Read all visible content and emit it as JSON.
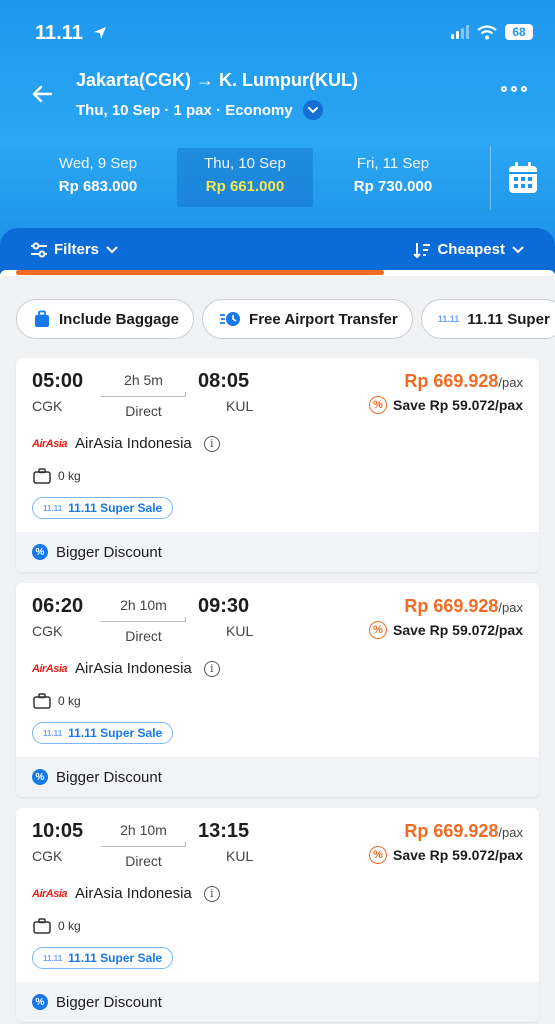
{
  "status_bar": {
    "time": "11.11",
    "battery": "68"
  },
  "header": {
    "route": "Jakarta(CGK) → K. Lumpur(KUL)",
    "subinfo": "Thu, 10 Sep · 1 pax · Economy"
  },
  "dates": [
    {
      "date": "Wed, 9 Sep",
      "price": "Rp 683.000"
    },
    {
      "date": "Thu, 10 Sep",
      "price": "Rp 661.000",
      "selected": true
    },
    {
      "date": "Fri, 11 Sep",
      "price": "Rp 730.000"
    }
  ],
  "filter_bar": {
    "filters_label": "Filters",
    "sort_label": "Cheapest"
  },
  "chips": [
    "Include Baggage",
    "Free Airport Transfer",
    "11.11 Super"
  ],
  "flights": [
    {
      "dep_time": "05:00",
      "dep_airport": "CGK",
      "duration": "2h 5m",
      "stops": "Direct",
      "arr_time": "08:05",
      "arr_airport": "KUL",
      "price": "Rp 669.928",
      "per": "/pax",
      "save": "Save Rp 59.072/pax",
      "airline": "AirAsia Indonesia",
      "logo": "AirAsia",
      "baggage": "0 kg",
      "tag": "11.11 Super Sale",
      "discount": "Bigger Discount"
    },
    {
      "dep_time": "06:20",
      "dep_airport": "CGK",
      "duration": "2h 10m",
      "stops": "Direct",
      "arr_time": "09:30",
      "arr_airport": "KUL",
      "price": "Rp 669.928",
      "per": "/pax",
      "save": "Save Rp 59.072/pax",
      "airline": "AirAsia Indonesia",
      "logo": "AirAsia",
      "baggage": "0 kg",
      "tag": "11.11 Super Sale",
      "discount": "Bigger Discount"
    },
    {
      "dep_time": "10:05",
      "dep_airport": "CGK",
      "duration": "2h 10m",
      "stops": "Direct",
      "arr_time": "13:15",
      "arr_airport": "KUL",
      "price": "Rp 669.928",
      "per": "/pax",
      "save": "Save Rp 59.072/pax",
      "airline": "AirAsia Indonesia",
      "logo": "AirAsia",
      "baggage": "0 kg",
      "tag": "11.11 Super Sale",
      "discount": "Bigger Discount"
    }
  ],
  "colors": {
    "brand_blue": "#1f97ee",
    "filter_blue": "#0b6bd7",
    "accent_orange": "#f26b22",
    "selected_price": "#f6e646"
  },
  "icons": [
    "location-arrow-icon",
    "signal-icon",
    "wifi-icon",
    "battery-icon",
    "back-arrow-icon",
    "chevron-down-icon",
    "more-icon",
    "calendar-icon",
    "filter-icon",
    "sort-icon",
    "baggage-icon",
    "shuttle-icon",
    "sale-icon",
    "percent-icon",
    "info-icon",
    "bag-icon",
    "discount-icon"
  ]
}
